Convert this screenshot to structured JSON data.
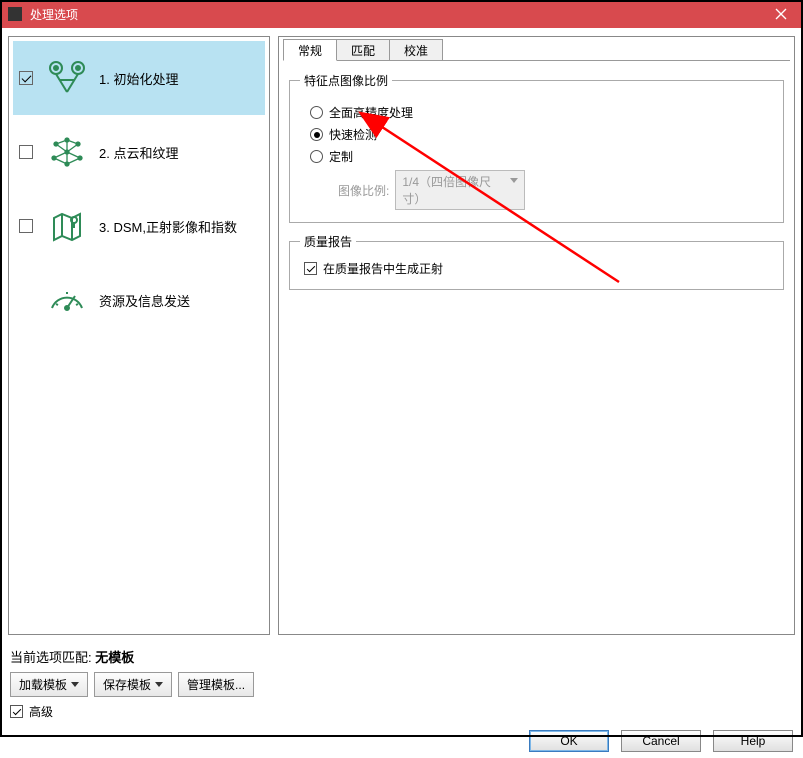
{
  "window": {
    "title": "处理选项"
  },
  "sidebar": {
    "items": [
      {
        "label": "1. 初始化处理",
        "checked": true,
        "active": true
      },
      {
        "label": "2. 点云和纹理",
        "checked": false,
        "active": false
      },
      {
        "label": "3. DSM,正射影像和指数",
        "checked": false,
        "active": false
      },
      {
        "label": "资源及信息发送",
        "checked": null,
        "active": false
      }
    ]
  },
  "tabs": {
    "items": [
      "常规",
      "匹配",
      "校准"
    ],
    "active": 0
  },
  "groups": {
    "features": {
      "legend": "特征点图像比例",
      "options": [
        "全面高精度处理",
        "快速检测",
        "定制"
      ],
      "selected": 1,
      "subLabel": "图像比例:",
      "subValue": "1/4（四倍图像尺寸）"
    },
    "quality": {
      "legend": "质量报告",
      "checkbox": "在质量报告中生成正射",
      "checked": true
    }
  },
  "footer": {
    "matchPrefix": "当前选项匹配: ",
    "matchValue": "无模板",
    "loadTemplate": "加载模板",
    "saveTemplate": "保存模板",
    "manageTemplate": "管理模板...",
    "advanced": "高级",
    "advancedChecked": true
  },
  "buttons": {
    "ok": "OK",
    "cancel": "Cancel",
    "help": "Help"
  }
}
